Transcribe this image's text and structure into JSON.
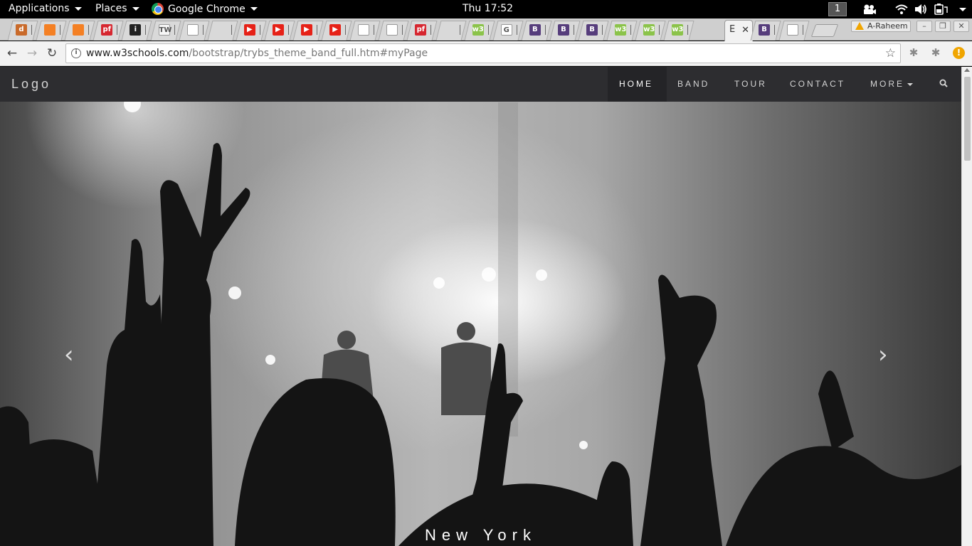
{
  "topbar": {
    "applications": "Applications",
    "places": "Places",
    "active_app": "Google Chrome",
    "clock": "Thu 17:52",
    "workspace": "1",
    "icons": [
      "camera-icon",
      "wifi-icon",
      "volume-icon",
      "battery-icon",
      "power-menu-icon"
    ]
  },
  "tabs": {
    "favicons": [
      {
        "name": "stackoverflow-dark-icon",
        "label": "d",
        "color": "#c96a2a"
      },
      {
        "name": "stackoverflow-icon",
        "label": "",
        "color": "#f48024"
      },
      {
        "name": "stackoverflow-icon",
        "label": "",
        "color": "#f48024"
      },
      {
        "name": "pf-icon",
        "label": "pf",
        "color": "#d6262f"
      },
      {
        "name": "dark-i-icon",
        "label": "i",
        "color": "#222222"
      },
      {
        "name": "tw-icon",
        "label": "TW",
        "color": "#f7f7f7"
      },
      {
        "name": "page-icon",
        "label": "",
        "color": "#ffffff"
      },
      {
        "name": "audio-icon",
        "label": "",
        "color": "#d9d9d9"
      },
      {
        "name": "youtube-icon",
        "label": "▶",
        "color": "#e62117"
      },
      {
        "name": "youtube-icon",
        "label": "▶",
        "color": "#e62117"
      },
      {
        "name": "youtube-icon",
        "label": "▶",
        "color": "#e62117"
      },
      {
        "name": "youtube-icon",
        "label": "▶",
        "color": "#e62117"
      },
      {
        "name": "page-icon",
        "label": "",
        "color": "#ffffff"
      },
      {
        "name": "page-icon",
        "label": "",
        "color": "#ffffff"
      },
      {
        "name": "pf-icon",
        "label": "pf",
        "color": "#d6262f"
      },
      {
        "name": "blank-tab",
        "label": "",
        "color": "#d9d9d9"
      },
      {
        "name": "w3schools-icon",
        "label": "w3",
        "color": "#8bc34a"
      },
      {
        "name": "google-icon",
        "label": "G",
        "color": "#ffffff"
      },
      {
        "name": "bootstrap-icon",
        "label": "B",
        "color": "#563d7c"
      },
      {
        "name": "bootstrap-icon",
        "label": "B",
        "color": "#563d7c"
      },
      {
        "name": "bootstrap-icon",
        "label": "B",
        "color": "#563d7c"
      },
      {
        "name": "w3schools-icon",
        "label": "w3",
        "color": "#8bc34a"
      },
      {
        "name": "w3schools-icon",
        "label": "w3",
        "color": "#8bc34a"
      },
      {
        "name": "w3schools-icon",
        "label": "w3",
        "color": "#8bc34a"
      }
    ],
    "active_label": "E",
    "after_active": [
      {
        "name": "bootstrap-icon",
        "label": "B",
        "color": "#563d7c"
      },
      {
        "name": "page-icon",
        "label": "",
        "color": "#ffffff"
      }
    ],
    "profile_name": "A-Raheem"
  },
  "toolbar": {
    "url_host": "www.w3schools.com",
    "url_path": "/bootstrap/trybs_theme_band_full.htm#myPage"
  },
  "site": {
    "logo": "Logo",
    "nav": [
      "HOME",
      "BAND",
      "TOUR",
      "CONTACT",
      "MORE"
    ],
    "caption": "New York",
    "colors": {
      "navbar": "#2d2d30",
      "nav_text": "#d5d5d5"
    }
  }
}
